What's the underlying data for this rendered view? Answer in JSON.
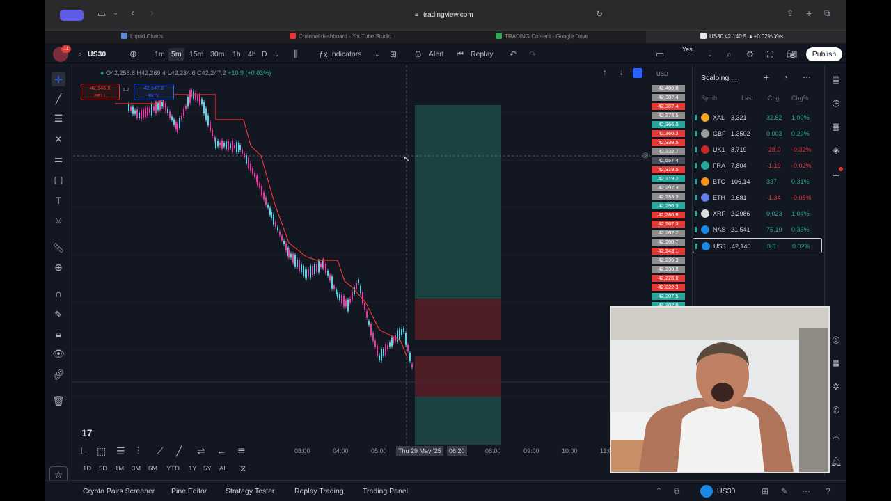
{
  "browser": {
    "url": "tradingview.com",
    "tabs": [
      {
        "title": "Liquid Charts",
        "color": "#5b8bd6"
      },
      {
        "title": "Channel dashboard - YouTube Studio",
        "color": "#e53935"
      },
      {
        "title": "TRADING Content - Google Drive",
        "color": "#34a853"
      },
      {
        "title": "US30 42,140.5 ▲+0.02% Yes",
        "color": "#e6e6e6"
      }
    ]
  },
  "toolbar": {
    "symbol": "US30",
    "intervals": [
      "1m",
      "5m",
      "15m",
      "30m",
      "1h",
      "4h",
      "D"
    ],
    "active_interval": "5m",
    "indicators_label": "Indicators",
    "alert_label": "Alert",
    "replay_label": "Replay",
    "account_label": "Yes",
    "publish_label": "Publish",
    "notification_count": "11"
  },
  "legend": {
    "open_label": "O42,2",
    "open_value": "56.8",
    "high": "H42,269.4",
    "low": "L42,234.6",
    "close": "C42,247.2",
    "change": "+10.9 (+0.03%)",
    "sell_price": "42,146.6",
    "sell_label": "SELL",
    "buy_price": "42,147.8",
    "buy_label": "BUY",
    "spread": "1.2"
  },
  "price_scale": {
    "currency": "USD",
    "labels": [
      {
        "v": "42,400.0",
        "c": "#8c8c8c"
      },
      {
        "v": "42,387.4",
        "c": "#8c8c8c"
      },
      {
        "v": "42,387.4",
        "c": "#e53935"
      },
      {
        "v": "42,373.5",
        "c": "#8c8c8c"
      },
      {
        "v": "42,366.0",
        "c": "#26a69a"
      },
      {
        "v": "42,360.2",
        "c": "#e53935"
      },
      {
        "v": "42,339.5",
        "c": "#e53935"
      },
      {
        "v": "42,332.7",
        "c": "#8c8c8c"
      },
      {
        "v": "42,557.4",
        "c": "#4a4f5c"
      },
      {
        "v": "42,319.5",
        "c": "#e53935"
      },
      {
        "v": "42,319.2",
        "c": "#26a69a"
      },
      {
        "v": "42,297.3",
        "c": "#8c8c8c"
      },
      {
        "v": "42,293.3",
        "c": "#8c8c8c"
      },
      {
        "v": "42,290.3",
        "c": "#26a69a"
      },
      {
        "v": "42,280.8",
        "c": "#e53935"
      },
      {
        "v": "42,267.3",
        "c": "#e53935"
      },
      {
        "v": "42,262.2",
        "c": "#8c8c8c"
      },
      {
        "v": "42,260.7",
        "c": "#8c8c8c"
      },
      {
        "v": "42,243.1",
        "c": "#e53935"
      },
      {
        "v": "42,235.3",
        "c": "#8c8c8c"
      },
      {
        "v": "42,233.8",
        "c": "#8c8c8c"
      },
      {
        "v": "42,226.0",
        "c": "#e53935"
      },
      {
        "v": "42,222.3",
        "c": "#e53935"
      },
      {
        "v": "42,207.5",
        "c": "#26a69a"
      },
      {
        "v": "42,202.0",
        "c": "#26a69a"
      }
    ]
  },
  "time_axis": {
    "labels": [
      "03:00",
      "04:00",
      "05:00",
      "Thu 29 May '25",
      "06:20",
      "08:00",
      "09:00",
      "10:00",
      "11:00"
    ]
  },
  "ranges": [
    "1D",
    "5D",
    "1M",
    "3M",
    "6M",
    "YTD",
    "1Y",
    "5Y",
    "All"
  ],
  "watchlist": {
    "title": "Scalping ...",
    "headers": [
      "Symb",
      "Last",
      "Chg",
      "Chg%"
    ],
    "rows": [
      {
        "sym": "XAL",
        "last": "3,321",
        "chg": "32.82",
        "pct": "1.00%",
        "icon": "#f5a623",
        "dir": "up"
      },
      {
        "sym": "GBF",
        "last": "1.3502",
        "chg": "0.003",
        "pct": "0.29%",
        "icon": "#9b9b9b",
        "dir": "up"
      },
      {
        "sym": "UK1",
        "last": "8,719",
        "chg": "-28.0",
        "pct": "-0.32%",
        "icon": "#c62828",
        "dir": "down"
      },
      {
        "sym": "FRA",
        "last": "7,804",
        "chg": "-1.19",
        "pct": "-0.02%",
        "icon": "#26a69a",
        "dir": "down"
      },
      {
        "sym": "BTC",
        "last": "106,14",
        "chg": "337",
        "pct": "0.31%",
        "icon": "#f7931a",
        "dir": "up"
      },
      {
        "sym": "ETH",
        "last": "2,681",
        "chg": "-1.34",
        "pct": "-0.05%",
        "icon": "#627eea",
        "dir": "down"
      },
      {
        "sym": "XRF",
        "last": "2.2986",
        "chg": "0.023",
        "pct": "1.04%",
        "icon": "#dddddd",
        "dir": "up"
      },
      {
        "sym": "NAS",
        "last": "21,541",
        "chg": "75.10",
        "pct": "0.35%",
        "icon": "#1e88e5",
        "dir": "up"
      },
      {
        "sym": "US3",
        "last": "42,146",
        "chg": "8.8",
        "pct": "0.02%",
        "icon": "#1e88e5",
        "dir": "up"
      }
    ]
  },
  "bottom": {
    "tabs": [
      "Crypto Pairs Screener",
      "Pine Editor",
      "Strategy Tester",
      "Replay Trading",
      "Trading Panel"
    ],
    "symbol": "US30"
  },
  "colors": {
    "bg": "#131722",
    "up": "#26a69a",
    "down": "#e91e63",
    "stop": "#e53935",
    "accent": "#2962ff"
  }
}
